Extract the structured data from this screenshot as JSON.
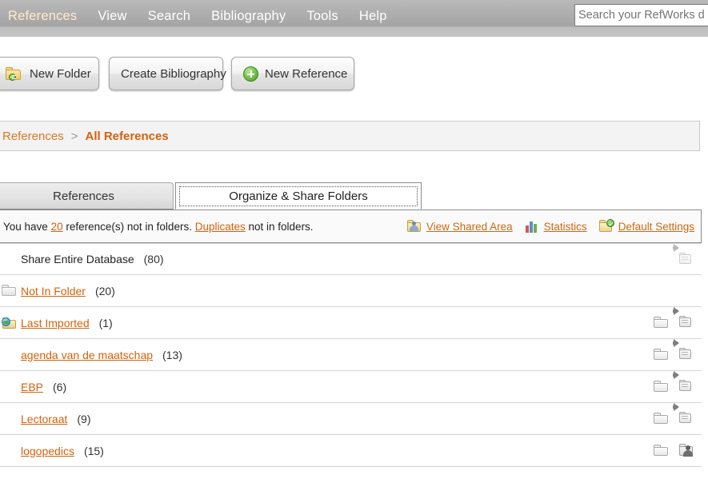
{
  "menu": {
    "items": [
      {
        "label": "References",
        "name": "menu-references"
      },
      {
        "label": "View",
        "name": "menu-view"
      },
      {
        "label": "Search",
        "name": "menu-search"
      },
      {
        "label": "Bibliography",
        "name": "menu-bibliography"
      },
      {
        "label": "Tools",
        "name": "menu-tools"
      },
      {
        "label": "Help",
        "name": "menu-help"
      }
    ]
  },
  "search": {
    "value": "",
    "placeholder": "Search your RefWorks d"
  },
  "toolbar": {
    "new_folder_label": "New Folder",
    "create_bibliography_label": "Create Bibliography",
    "new_reference_label": "New Reference"
  },
  "breadcrumb": {
    "root": "References",
    "separator": ">",
    "current": "All References"
  },
  "tabs": {
    "references_label": "References",
    "organize_label": "Organize & Share Folders"
  },
  "infobar": {
    "text_before": "You have",
    "count": "20",
    "text_middle": "reference(s) not in folders.",
    "duplicates_label": "Duplicates",
    "text_after": "not in folders.",
    "actions": [
      {
        "label": "View Shared Area",
        "icon": "shared-folder-icon"
      },
      {
        "label": "Statistics",
        "icon": "bar-chart-icon"
      },
      {
        "label": "Default Settings",
        "icon": "check-folder-icon"
      }
    ]
  },
  "folders": [
    {
      "name": "Share Entire Database",
      "count": "(80)",
      "is_link": false,
      "left_icon": "none",
      "has_folder_action": false,
      "share_icon": "share-folder-icon-disabled"
    },
    {
      "name": "Not In Folder",
      "count": "(20)",
      "is_link": true,
      "left_icon": "gray-folder-icon",
      "has_folder_action": false,
      "share_icon": "none"
    },
    {
      "name": "Last Imported",
      "count": "(1)",
      "is_link": true,
      "left_icon": "globe-folder-icon",
      "has_folder_action": true,
      "share_icon": "share-folder-icon"
    },
    {
      "name": "agenda van de maatschap",
      "count": "(13)",
      "is_link": true,
      "left_icon": "none",
      "has_folder_action": true,
      "share_icon": "share-folder-icon"
    },
    {
      "name": "EBP",
      "count": "(6)",
      "is_link": true,
      "left_icon": "none",
      "has_folder_action": true,
      "share_icon": "share-folder-icon"
    },
    {
      "name": "Lectoraat",
      "count": "(9)",
      "is_link": true,
      "left_icon": "none",
      "has_folder_action": true,
      "share_icon": "share-folder-icon"
    },
    {
      "name": "logopedics",
      "count": "(15)",
      "is_link": true,
      "left_icon": "none",
      "has_folder_action": true,
      "share_icon": "shared-person-icon"
    }
  ],
  "colors": {
    "link_orange": "#d4620c",
    "menu_gray": "#adadad",
    "breadcrumb_bg": "#f3f3f3"
  }
}
